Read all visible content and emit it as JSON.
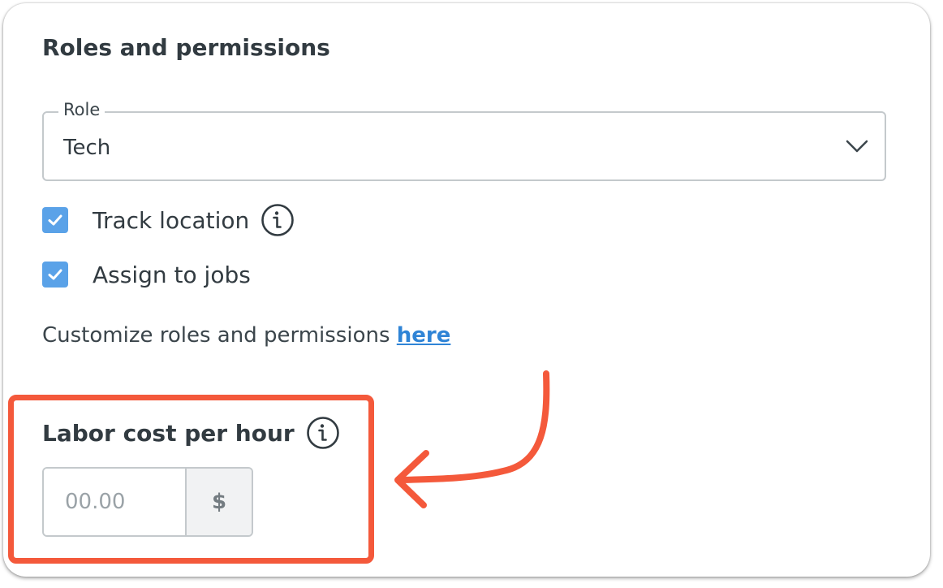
{
  "section": {
    "title": "Roles and permissions"
  },
  "role_select": {
    "label": "Role",
    "value": "Tech"
  },
  "checkboxes": [
    {
      "label": "Track location",
      "checked": true,
      "has_info": true
    },
    {
      "label": "Assign to jobs",
      "checked": true,
      "has_info": false
    }
  ],
  "customize": {
    "text": "Customize roles and permissions ",
    "link": "here"
  },
  "labor_cost": {
    "title": "Labor cost per hour",
    "placeholder": "00.00",
    "currency": "$"
  },
  "colors": {
    "accent": "#5aa2e8",
    "link": "#2f84d6",
    "highlight": "#f4593b"
  },
  "icons": {
    "dropdown": "chevron-down-icon",
    "info": "info-icon",
    "check": "checkmark-icon",
    "annotation": "curved-arrow-icon"
  }
}
